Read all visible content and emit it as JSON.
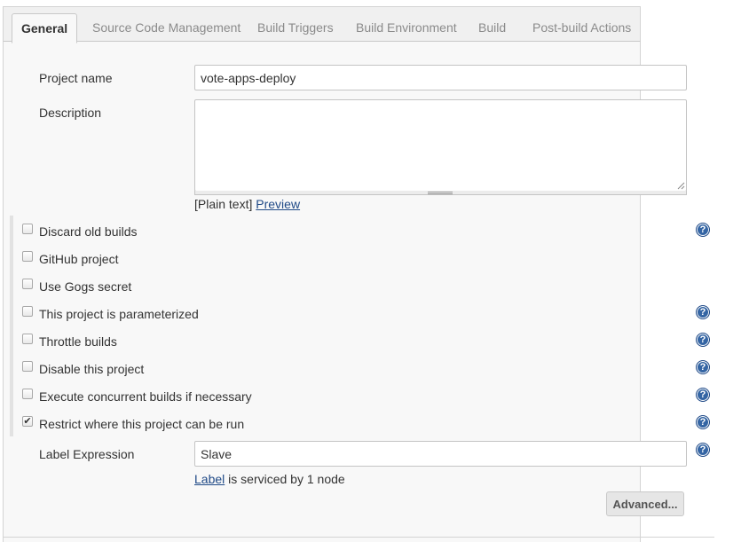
{
  "tabs": [
    {
      "label": "General",
      "active": true
    },
    {
      "label": "Source Code Management"
    },
    {
      "label": "Build Triggers"
    },
    {
      "label": "Build Environment"
    },
    {
      "label": "Build"
    },
    {
      "label": "Post-build Actions"
    }
  ],
  "form": {
    "project_name_label": "Project name",
    "project_name_value": "vote-apps-deploy",
    "description_label": "Description",
    "description_value": "",
    "format_prefix": "[Plain text]",
    "preview_link": "Preview"
  },
  "options": [
    {
      "label": "Discard old builds",
      "checked": false,
      "help": true
    },
    {
      "label": "GitHub project",
      "checked": false,
      "help": false
    },
    {
      "label": "Use Gogs secret",
      "checked": false,
      "help": false
    },
    {
      "label": "This project is parameterized",
      "checked": false,
      "help": true
    },
    {
      "label": "Throttle builds",
      "checked": false,
      "help": true
    },
    {
      "label": "Disable this project",
      "checked": false,
      "help": true
    },
    {
      "label": "Execute concurrent builds if necessary",
      "checked": false,
      "help": true
    },
    {
      "label": "Restrict where this project can be run",
      "checked": true,
      "help": true
    }
  ],
  "label_expression": {
    "label": "Label Expression",
    "value": "Slave",
    "status_link": "Label",
    "status_text": "is serviced by 1 node"
  },
  "advanced_button": "Advanced...",
  "icons": {
    "help": "help-icon",
    "check": "check-icon"
  },
  "colors": {
    "link": "#204a87",
    "help_icon": "#3465a4"
  }
}
